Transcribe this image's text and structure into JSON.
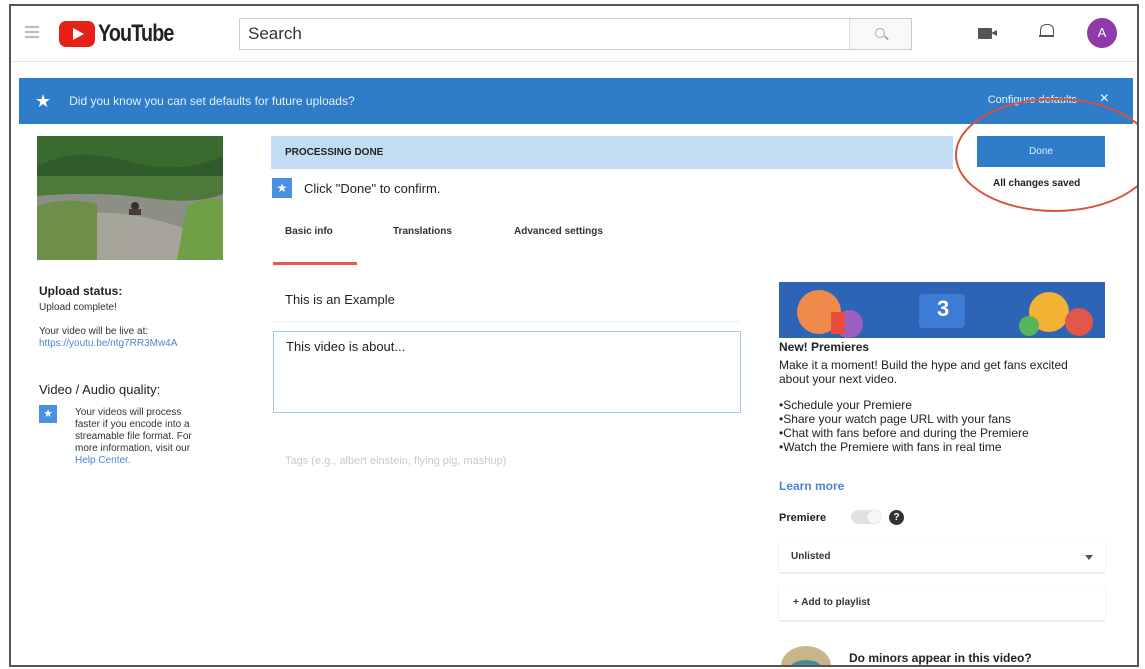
{
  "app": {
    "logo_text": "YouTube"
  },
  "header": {
    "search_placeholder": "Search",
    "avatar_letter": "A"
  },
  "banner": {
    "text": "Did you know you can set defaults for future uploads?",
    "link": "Configure defaults",
    "close": "×"
  },
  "left": {
    "upload_status_label": "Upload status:",
    "upload_complete": "Upload complete!",
    "live_at": "Your video will be live at:",
    "video_url": "https://youtu.be/ntg7RR3Mw4A",
    "quality_label": "Video / Audio quality:",
    "quality_desc_1": "Your videos will process",
    "quality_desc_2": "faster if you encode into a",
    "quality_desc_3": "streamable file format. For",
    "quality_desc_4": "more information, visit our",
    "help_link": "Help Center."
  },
  "main": {
    "processing": "PROCESSING DONE",
    "confirm": "Click \"Done\" to confirm.",
    "tabs": [
      "Basic info",
      "Translations",
      "Advanced settings"
    ],
    "title_value": "This is an Example",
    "description_value": "This video is about...",
    "tags_placeholder": "Tags (e.g., albert einstein, flying pig, mashup)"
  },
  "right": {
    "done_button": "Done",
    "saved": "All changes saved",
    "promo_number": "3",
    "promo_title": "New! Premieres",
    "promo_desc": "Make it a moment! Build the hype and get fans excited about your next video.",
    "promo_items": [
      "Schedule your Premiere",
      "Share your watch page URL with your fans",
      "Chat with fans before and during the Premiere",
      "Watch the Premiere with fans in real time"
    ],
    "learn_more": "Learn more",
    "premiere_label": "Premiere",
    "premiere_enabled": false,
    "help_glyph": "?",
    "visibility": "Unlisted",
    "add_playlist": "+ Add to playlist",
    "minors_question": "Do minors appear in this video?"
  },
  "colors": {
    "brand_red": "#e62117",
    "banner_blue": "#2f7dc8",
    "processing_bar": "#c2dcf3",
    "annotation_circle": "#d9533a"
  }
}
